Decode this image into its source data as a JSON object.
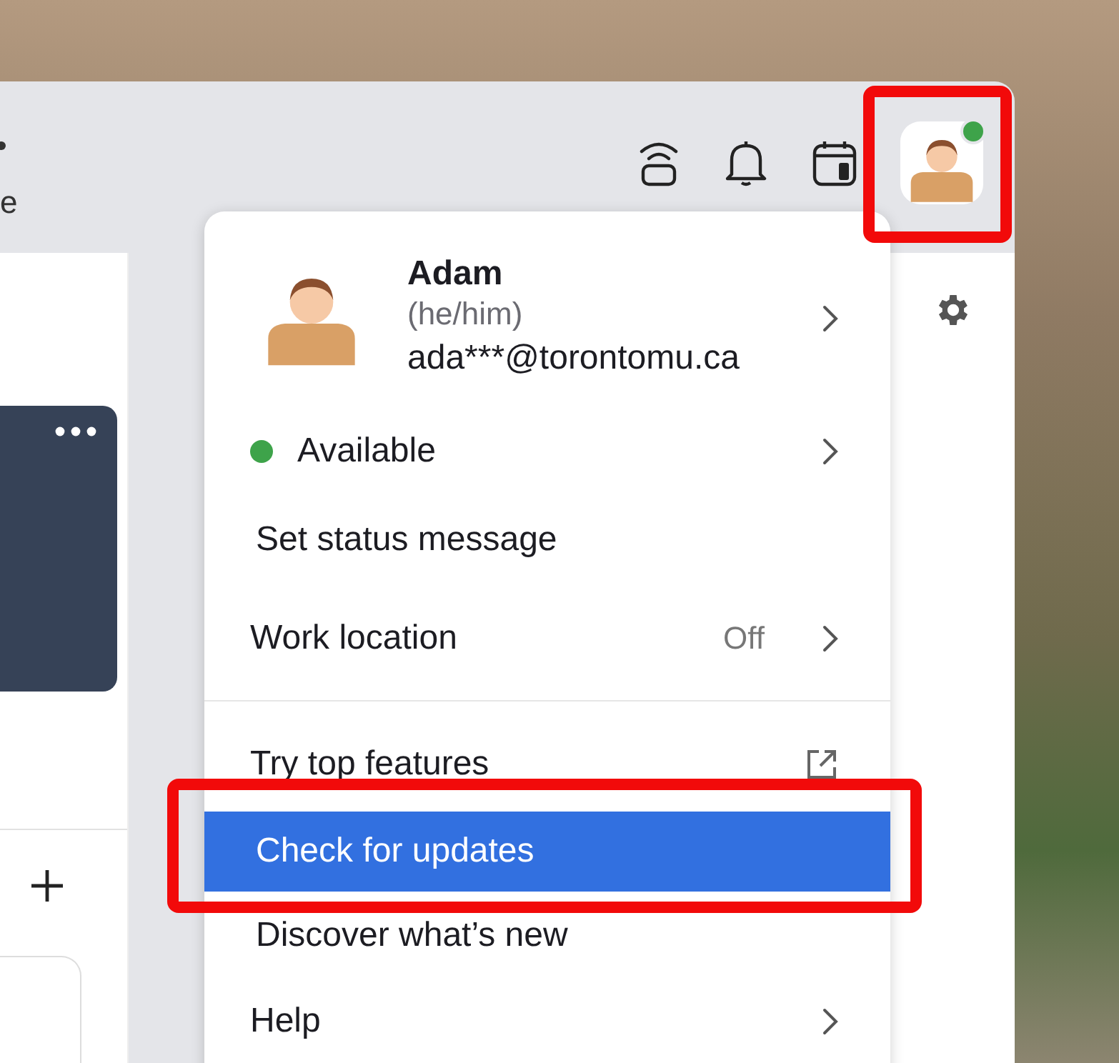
{
  "left_panel": {
    "fragment": "e"
  },
  "account": {
    "online": true
  },
  "profile": {
    "name": "Adam",
    "pronouns": "(he/him)",
    "email": "ada***@torontomu.ca"
  },
  "menu": [
    {
      "kind": "presence",
      "label": "Available",
      "color": "#3ea34a",
      "selected": false
    },
    {
      "kind": "plain",
      "label": "Set status message",
      "selected": false
    },
    {
      "kind": "submenu",
      "label": "Work location",
      "value": "Off",
      "selected": false
    },
    {
      "kind": "divider"
    },
    {
      "kind": "external",
      "label": "Try top features",
      "selected": false
    },
    {
      "kind": "plain",
      "label": "Check for updates",
      "selected": true
    },
    {
      "kind": "plain",
      "label": "Discover what’s new",
      "selected": false
    },
    {
      "kind": "submenu",
      "label": "Help",
      "selected": false
    }
  ]
}
